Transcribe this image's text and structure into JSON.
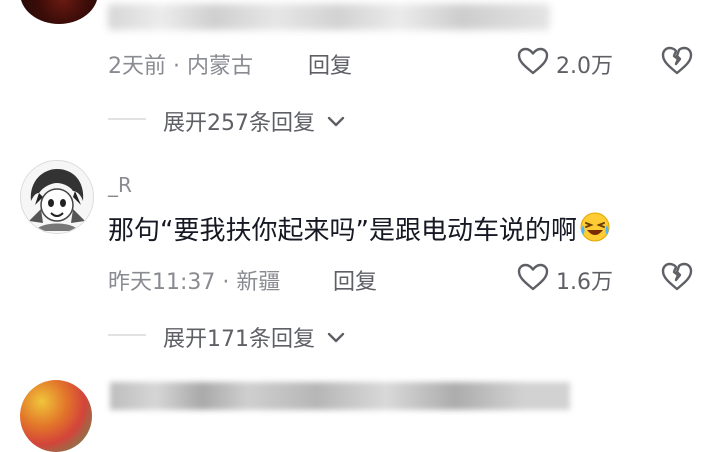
{
  "comments": [
    {
      "meta": "2天前 · 内蒙古",
      "reply_label": "回复",
      "likes": "2.0万",
      "expand_label": "展开257条回复"
    },
    {
      "username": "_R",
      "text": "那句“要我扶你起来吗”是跟电动车说的啊",
      "emoji": "laughing-crying-emoji",
      "meta": "昨天11:37 · 新疆",
      "reply_label": "回复",
      "likes": "1.6万",
      "expand_label": "展开171条回复"
    }
  ],
  "colors": {
    "text": "#161823",
    "meta": "#8a8b91",
    "secondary": "#5f6066",
    "divider": "#e2e2e4"
  }
}
